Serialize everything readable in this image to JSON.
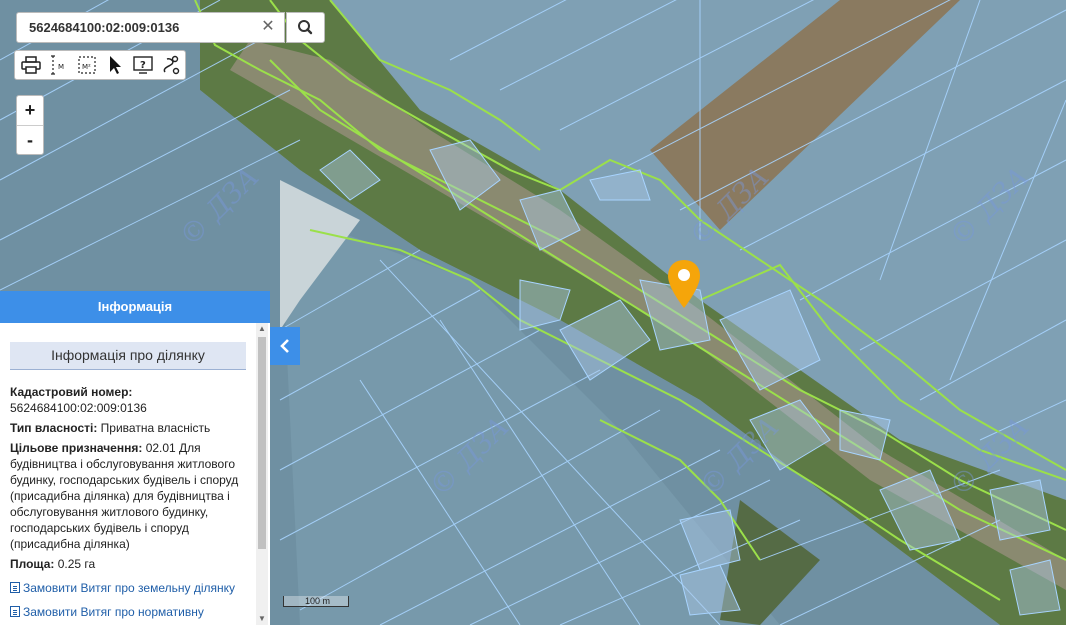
{
  "search": {
    "value": "5624684100:02:009:0136"
  },
  "watermark": "© ДЗА",
  "panel": {
    "header": "Інформація",
    "title": "Інформація про ділянку",
    "cadastral_label": "Кадастровий номер:",
    "cadastral_value": "5624684100:02:009:0136",
    "ownership_label": "Тип власності:",
    "ownership_value": "Приватна власність",
    "purpose_label": "Цільове призначення:",
    "purpose_value": "02.01 Для будівництва і обслуговування житлового будинку, господарських будівель і споруд (присадибна ділянка) для будівництва і обслуговування житлового будинку, господарських будівель і споруд (присадибна ділянка)",
    "area_label": "Площа:",
    "area_value": "0.25 га",
    "link1": "Замовити Витяг про земельну ділянку",
    "link2": "Замовити Витяг про нормативну грошову оцінку"
  },
  "scale": {
    "label": "100 m"
  },
  "icons": [
    "close-icon",
    "search-icon",
    "print-icon",
    "measure-length-icon",
    "measure-area-icon",
    "pointer-icon",
    "info-query-icon",
    "route-icon",
    "chevron-left-icon",
    "map-marker-icon"
  ]
}
